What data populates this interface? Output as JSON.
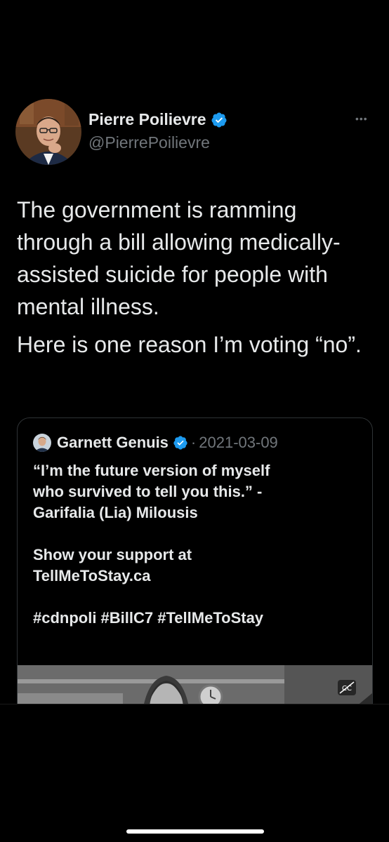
{
  "tweet": {
    "author": {
      "name": "Pierre Poilievre",
      "handle": "@PierrePoilievre"
    },
    "more_icon": "more-horizontal-icon",
    "paragraphs": [
      "The government is ramming through a bill allowing medically-assisted suicide for people with mental illness.",
      "Here is one reason I’m voting “no”."
    ]
  },
  "quote": {
    "author_name": "Garnett Genuis",
    "separator": "·",
    "date": "2021-03-09",
    "lines": [
      "“I’m the future version of myself",
      "who survived to tell you this.” -",
      "Garifalia (Lia) Milousis",
      "",
      "Show your support at",
      "TellMeToStay.ca",
      "",
      "#cdnpoli #BillC7 #TellMeToStay"
    ],
    "media_icon": "closed-captions-icon"
  },
  "colors": {
    "background": "#000000",
    "text": "#e7e9ea",
    "secondary_text": "#71767b",
    "verified": "#1d9bf0",
    "border": "#2f3336"
  }
}
